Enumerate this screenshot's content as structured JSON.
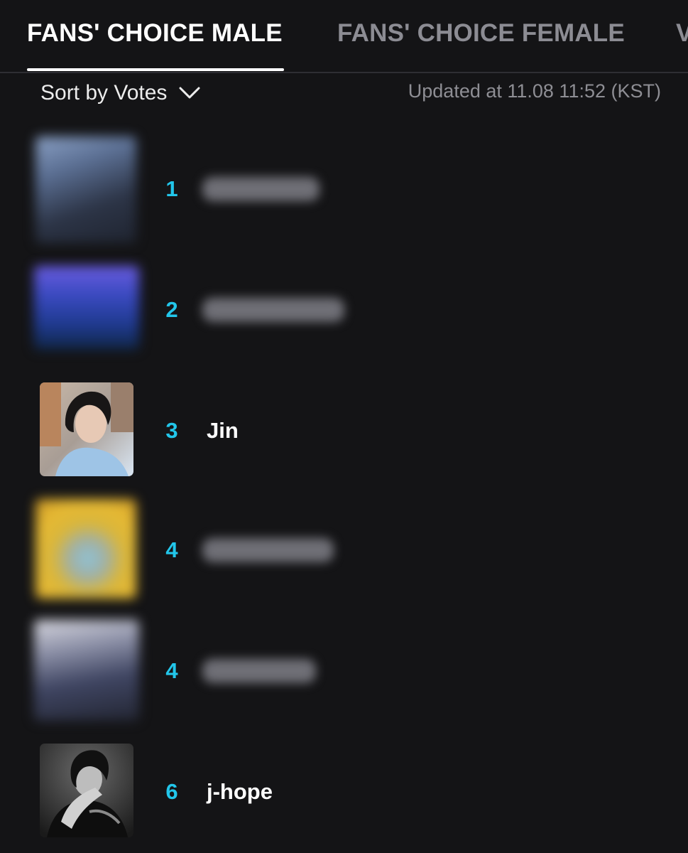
{
  "tabs": [
    {
      "label": "FANS' CHOICE MALE",
      "active": true
    },
    {
      "label": "FANS' CHOICE FEMALE",
      "active": false
    },
    {
      "label": "V",
      "active": false
    }
  ],
  "sort": {
    "label": "Sort by Votes",
    "icon": "chevron-down-icon"
  },
  "updated_text": "Updated at 11.08 11:52 (KST)",
  "colors": {
    "background": "#141416",
    "rank": "#22c6ea",
    "active_tab": "#ffffff",
    "inactive_tab": "#8c8c93"
  },
  "rankings": [
    {
      "rank": "1",
      "name": "",
      "hidden": true
    },
    {
      "rank": "2",
      "name": "",
      "hidden": true
    },
    {
      "rank": "3",
      "name": "Jin",
      "hidden": false
    },
    {
      "rank": "4",
      "name": "",
      "hidden": true
    },
    {
      "rank": "4",
      "name": "",
      "hidden": true
    },
    {
      "rank": "6",
      "name": "j-hope",
      "hidden": false
    }
  ]
}
